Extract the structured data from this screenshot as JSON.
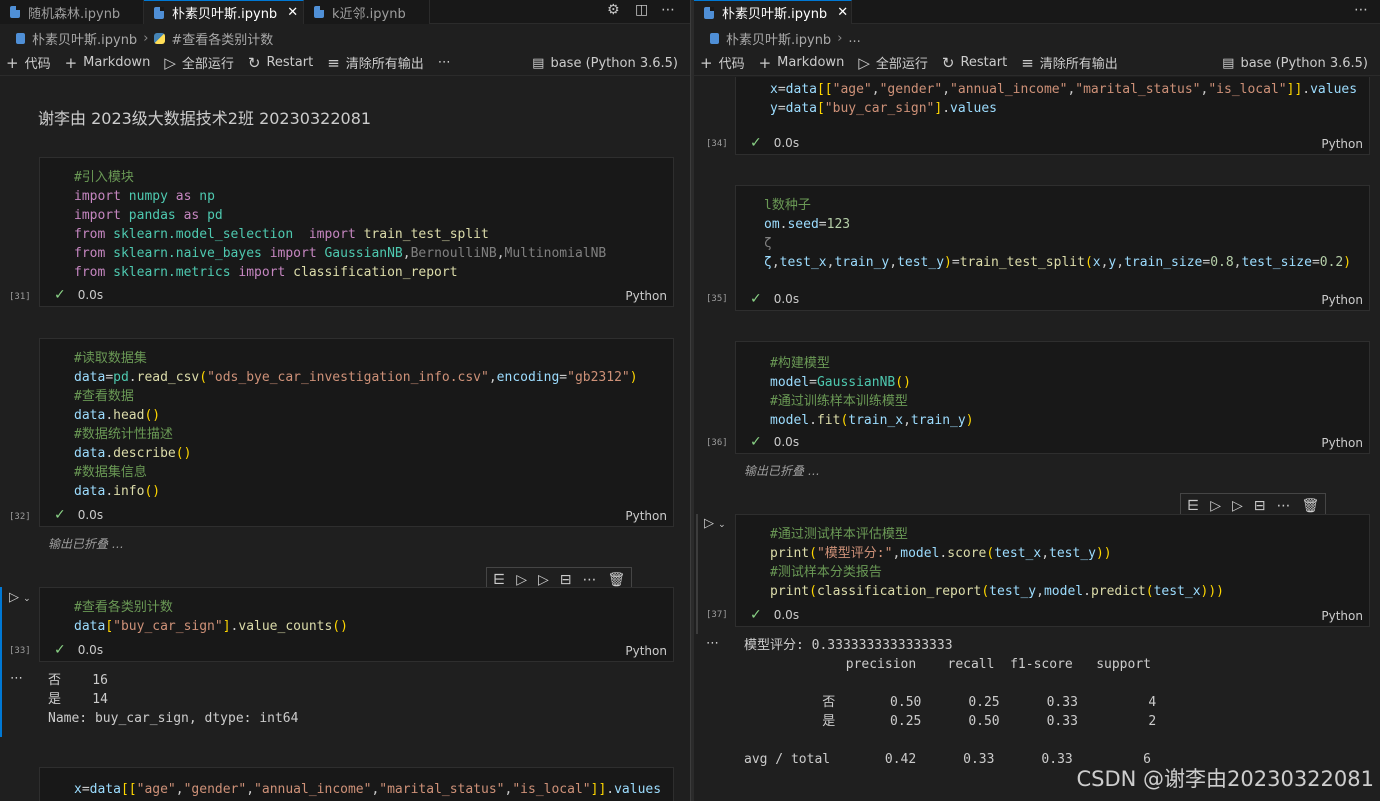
{
  "left": {
    "tabs": [
      {
        "label": "随机森林.ipynb",
        "active": false
      },
      {
        "label": "朴素贝叶斯.ipynb",
        "active": true
      },
      {
        "label": "k近邻.ipynb",
        "active": false
      }
    ],
    "breadcrumb": {
      "file": "朴素贝叶斯.ipynb",
      "section": "#查看各类别计数"
    },
    "toolbar": {
      "code": "代码",
      "markdown": "Markdown",
      "run_all": "全部运行",
      "restart": "Restart",
      "clear": "清除所有输出",
      "kernel": "base (Python 3.6.5)"
    },
    "markdown_title": "谢李由 2023级大数据技术2班 20230322081",
    "cell31": {
      "num": "[31]",
      "time": "0.0s",
      "lang": "Python",
      "lines": [
        "#引入模块",
        "import numpy as np",
        "import pandas as pd",
        "from sklearn.model_selection  import train_test_split",
        "from sklearn.naive_bayes import GaussianNB,BernoulliNB,MultinomialNB",
        "from sklearn.metrics import classification_report"
      ]
    },
    "cell32": {
      "num": "[32]",
      "time": "0.0s",
      "lang": "Python",
      "collapsed": "输出已折叠 …",
      "lines": [
        "#读取数据集",
        "data=pd.read_csv(\"ods_bye_car_investigation_info.csv\",encoding=\"gb2312\")",
        "#查看数据",
        "data.head()",
        "#数据统计性描述",
        "data.describe()",
        "#数据集信息",
        "data.info()"
      ]
    },
    "cell33": {
      "num": "[33]",
      "time": "0.0s",
      "lang": "Python",
      "lines": [
        "#查看各类别计数",
        "data[\"buy_car_sign\"].value_counts()"
      ],
      "output": [
        "否    16",
        "是    14",
        "Name: buy_car_sign, dtype: int64"
      ]
    },
    "cell34_partial": {
      "line": "x=data[[\"age\",\"gender\",\"annual_income\",\"marital_status\",\"is_local\"]].values"
    }
  },
  "right": {
    "tabs": [
      {
        "label": "朴素贝叶斯.ipynb",
        "active": true
      }
    ],
    "breadcrumb": {
      "file": "朴素贝叶斯.ipynb",
      "section": "..."
    },
    "toolbar": {
      "code": "代码",
      "markdown": "Markdown",
      "run_all": "全部运行",
      "restart": "Restart",
      "clear": "清除所有输出",
      "kernel": "base (Python 3.6.5)"
    },
    "cell34": {
      "num": "[34]",
      "time": "0.0s",
      "lang": "Python",
      "lines": [
        "x=data[[\"age\",\"gender\",\"annual_income\",\"marital_status\",\"is_local\"]].values",
        "y=data[\"buy_car_sign\"].values"
      ]
    },
    "cell35": {
      "num": "[35]",
      "time": "0.0s",
      "lang": "Python",
      "lines": [
        "l数种子",
        "om.seed=123",
        "ζ",
        "ζ,test_x,train_y,test_y)=train_test_split(x,y,train_size=0.8,test_size=0.2)"
      ]
    },
    "cell36": {
      "num": "[36]",
      "time": "0.0s",
      "lang": "Python",
      "collapsed": "输出已折叠 …",
      "lines": [
        "#构建模型",
        "model=GaussianNB()",
        "#通过训练样本训练模型",
        "model.fit(train_x,train_y)"
      ]
    },
    "cell37": {
      "num": "[37]",
      "time": "0.0s",
      "lang": "Python",
      "lines": [
        "#通过测试样本评估模型",
        "print(\"模型评分:\",model.score(test_x,test_y))",
        "#测试样本分类报告",
        "print(classification_report(test_y,model.predict(test_x)))"
      ],
      "output": [
        "模型评分: 0.3333333333333333",
        "             precision    recall  f1-score   support",
        "",
        "          否       0.50      0.25      0.33         4",
        "          是       0.25      0.50      0.33         2",
        "",
        "avg / total       0.42      0.33      0.33         6"
      ]
    }
  },
  "watermark": "CSDN @谢李由20230322081"
}
